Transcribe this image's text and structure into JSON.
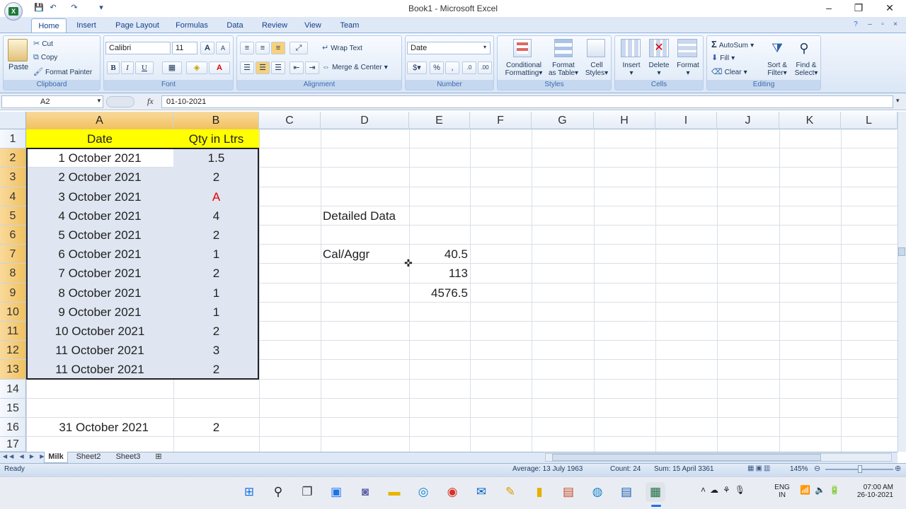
{
  "window": {
    "title": "Book1 - Microsoft Excel",
    "minimize": "–",
    "restore": "❐",
    "close": "✕"
  },
  "qat": {
    "save": "💾",
    "undo": "↶",
    "redo": "↷",
    "more": "▾"
  },
  "tabs": [
    "Home",
    "Insert",
    "Page Layout",
    "Formulas",
    "Data",
    "Review",
    "View",
    "Team"
  ],
  "ribbon": {
    "clipboard": {
      "paste": "Paste",
      "cut": "Cut",
      "copy": "Copy",
      "format_painter": "Format Painter",
      "label": "Clipboard"
    },
    "font": {
      "name": "Calibri",
      "size": "11",
      "bold": "B",
      "italic": "I",
      "underline": "U",
      "grow": "A",
      "shrink": "A",
      "label": "Font"
    },
    "alignment": {
      "wrap_text": "Wrap Text",
      "merge_center": "Merge & Center",
      "label": "Alignment"
    },
    "number": {
      "format": "Date",
      "percent": "%",
      "comma": ",",
      "label": "Number"
    },
    "styles": {
      "conditional": "Conditional",
      "conditional2": "Formatting",
      "format_table": "Format",
      "format_table2": "as Table",
      "cell_styles": "Cell",
      "cell_styles2": "Styles",
      "label": "Styles"
    },
    "cells": {
      "insert": "Insert",
      "delete": "Delete",
      "format": "Format",
      "label": "Cells"
    },
    "editing": {
      "autosum": "AutoSum",
      "fill": "Fill",
      "clear": "Clear",
      "sort": "Sort &",
      "sort2": "Filter",
      "find": "Find &",
      "find2": "Select",
      "label": "Editing"
    }
  },
  "formula_bar": {
    "name_box": "A2",
    "fx": "fx",
    "value": "01-10-2021"
  },
  "columns": [
    "A",
    "B",
    "C",
    "D",
    "E",
    "F",
    "G",
    "H",
    "I",
    "J",
    "K",
    "L"
  ],
  "rows": [
    "1",
    "2",
    "3",
    "4",
    "5",
    "6",
    "7",
    "8",
    "9",
    "10",
    "11",
    "12",
    "13",
    "14",
    "15",
    "16",
    "17"
  ],
  "cells": {
    "A1": "Date",
    "B1": "Qty in Ltrs",
    "A2": "1 October 2021",
    "B2": "1.5",
    "A3": "2 October 2021",
    "B3": "2",
    "A4": "3 October 2021",
    "B4": "A",
    "A5": "4 October 2021",
    "B5": "4",
    "A6": "5 October 2021",
    "B6": "2",
    "A7": "6 October 2021",
    "B7": "1",
    "A8": "7 October 2021",
    "B8": "2",
    "A9": "8 October 2021",
    "B9": "1",
    "A10": "9 October 2021",
    "B10": "1",
    "A11": "10 October 2021",
    "B11": "2",
    "A12": "11 October 2021",
    "B12": "3",
    "A13": "11 October 2021",
    "B13": "2",
    "A16": "31 October 2021",
    "B16": "2",
    "D5": "Detailed Data",
    "D7": "Cal/Aggr",
    "E7": "40.5",
    "E8": "113",
    "E9": "4576.5"
  },
  "colors": {
    "header_fill": "#ffff00",
    "selection_fill": "#dfe6f1",
    "error_text": "#e00000",
    "selected_header": "#f5c86a"
  },
  "sheets": [
    "Milk",
    "Sheet2",
    "Sheet3"
  ],
  "status": {
    "ready": "Ready",
    "average": "Average: 13 July 1963",
    "count": "Count: 24",
    "sum": "Sum: 15 April 3361",
    "zoom": "145%"
  },
  "taskbar": {
    "lang1": "ENG",
    "lang2": "IN",
    "time": "07:00 AM",
    "date": "26-10-2021"
  }
}
